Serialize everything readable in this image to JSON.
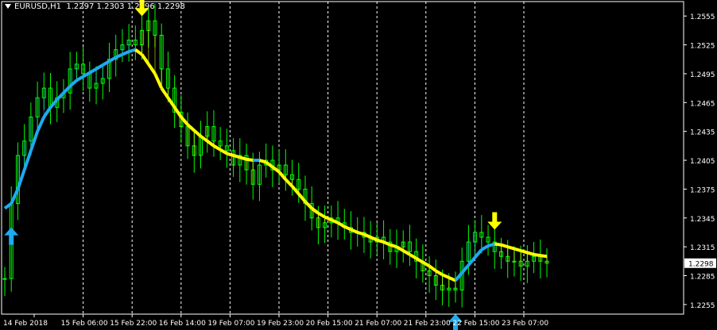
{
  "header": {
    "symbol": "EURUSD,H1",
    "quote": "1.2297 1.2303 1.2296 1.2298"
  },
  "colors": {
    "background": "#000000",
    "axis": "#ffffff",
    "grid": "#ffffff",
    "candle": "#00ff00",
    "ma_up": "#1eaaf0",
    "ma_down": "#ffff00",
    "price_box_bg": "#ffffff",
    "price_box_text": "#000000"
  },
  "price_axis": {
    "labels": [
      "1.2555",
      "1.2525",
      "1.2495",
      "1.2465",
      "1.2435",
      "1.2405",
      "1.2375",
      "1.2345",
      "1.2315",
      "1.2285",
      "1.2255"
    ],
    "current_price": "1.2298"
  },
  "time_axis": {
    "labels": [
      "14 Feb 2018",
      "15 Feb 06:00",
      "15 Feb 22:00",
      "16 Feb 14:00",
      "19 Feb 07:00",
      "19 Feb 23:00",
      "20 Feb 15:00",
      "21 Feb 07:00",
      "21 Feb 23:00",
      "22 Feb 15:00",
      "23 Feb 07:00"
    ]
  },
  "chart_data": {
    "type": "line",
    "symbol": "EURUSD",
    "timeframe": "H1",
    "y_range": [
      1.2245,
      1.257
    ],
    "grid": "vertical-dotted",
    "price_series": [
      1.2282,
      1.236,
      1.241,
      1.2425,
      1.245,
      1.247,
      1.248,
      1.246,
      1.247,
      1.2475,
      1.25,
      1.2505,
      1.2495,
      1.248,
      1.2485,
      1.249,
      1.251,
      1.252,
      1.2525,
      1.253,
      1.2525,
      1.254,
      1.255,
      1.2535,
      1.25,
      1.248,
      1.2455,
      1.244,
      1.242,
      1.241,
      1.243,
      1.244,
      1.2425,
      1.242,
      1.2415,
      1.24,
      1.241,
      1.2395,
      1.238,
      1.24,
      1.2405,
      1.2395,
      1.24,
      1.239,
      1.2385,
      1.2375,
      1.236,
      1.2345,
      1.2335,
      1.234,
      1.2345,
      1.234,
      1.2335,
      1.233,
      1.233,
      1.2325,
      1.232,
      1.2325,
      1.232,
      1.231,
      1.2315,
      1.232,
      1.231,
      1.23,
      1.229,
      1.2285,
      1.2275,
      1.227,
      1.2272,
      1.227,
      1.23,
      1.232,
      1.233,
      1.2325,
      1.232,
      1.231,
      1.2305,
      1.23,
      1.23,
      1.2295,
      1.23,
      1.2305,
      1.23,
      1.2298
    ],
    "ma_series": [
      {
        "name": "",
        "values": [
          1.2355,
          1.236,
          1.2375,
          1.2395,
          1.2415,
          1.2435,
          1.245,
          1.246,
          1.2468,
          1.2475,
          1.2482,
          1.2488,
          1.2492,
          1.2496,
          1.25,
          1.2504,
          1.2508,
          1.2512,
          1.2515,
          1.2518,
          1.252,
          1.2515,
          1.2505,
          1.2495,
          1.248,
          1.247,
          1.246,
          1.245,
          1.2442,
          1.2436,
          1.243,
          1.2425,
          1.242,
          1.2416,
          1.2412,
          1.241,
          1.2408,
          1.2406,
          1.2405,
          1.2405,
          1.2403,
          1.2398,
          1.2393,
          1.2385,
          1.2378,
          1.237,
          1.2362,
          1.2355,
          1.235,
          1.2346,
          1.2343,
          1.234,
          1.2336,
          1.2333,
          1.233,
          1.2328,
          1.2325,
          1.2322,
          1.232,
          1.2317,
          1.2315,
          1.2311,
          1.2307,
          1.2303,
          1.2299,
          1.2295,
          1.229,
          1.2286,
          1.2283,
          1.228,
          1.2288,
          1.2296,
          1.2304,
          1.2312,
          1.2316,
          1.2318,
          1.2317,
          1.2315,
          1.2313,
          1.2311,
          1.2309,
          1.2307,
          1.2306,
          1.2305
        ]
      }
    ],
    "signals": [
      {
        "type": "up",
        "index": 1
      },
      {
        "type": "down",
        "index": 21
      },
      {
        "type": "up",
        "index": 69
      },
      {
        "type": "down",
        "index": 75
      }
    ]
  }
}
